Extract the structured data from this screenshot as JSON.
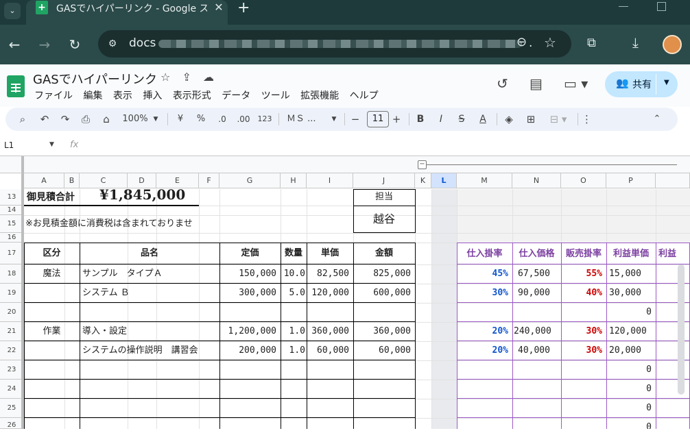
{
  "browser": {
    "tab_title": "GASでハイパーリンク - Google スプ",
    "url_prefix": "docs",
    "url_suffix": "."
  },
  "sheets": {
    "doc_title": "GASでハイパーリンク",
    "menus": [
      "ファイル",
      "編集",
      "表示",
      "挿入",
      "表示形式",
      "データ",
      "ツール",
      "拡張機能",
      "ヘルプ"
    ],
    "share_label": "共有"
  },
  "toolbar": {
    "zoom": "100%",
    "currency": "¥",
    "percent": "%",
    "dec_decrease": ".0",
    "dec_increase": ".00",
    "number_format": "123",
    "font": "ＭＳ ...",
    "font_size": "11",
    "bold": "B",
    "italic": "I",
    "strike": "S",
    "text_color": "A"
  },
  "formula_bar": {
    "name_box": "L1",
    "fx": "fx"
  },
  "columns": [
    "A",
    "B",
    "C",
    "D",
    "E",
    "F",
    "G",
    "H",
    "I",
    "J",
    "K",
    "L",
    "M",
    "N",
    "O",
    "P",
    ""
  ],
  "rows": [
    "13",
    "14",
    "15",
    "16",
    "17",
    "18",
    "19",
    "20",
    "21",
    "22",
    "23",
    "24",
    "25",
    "26"
  ],
  "sheet": {
    "total_label": "御見積合計",
    "total_value": "¥1,845,000",
    "tanto_label": "担当",
    "tanto_name": "越谷",
    "note": "※お見積金額に消費税は含まれておりませ",
    "table_headers": [
      "区分",
      "品名",
      "定価",
      "数量",
      "単価",
      "金額"
    ],
    "lines": [
      {
        "kubun": "魔法",
        "name": "サンプル　タイプＡ",
        "list_price": "150,000",
        "qty": "10.0",
        "unit": "82,500",
        "amount": "825,000"
      },
      {
        "kubun": "",
        "name": "システム Ｂ",
        "list_price": "300,000",
        "qty": "5.0",
        "unit": "120,000",
        "amount": "600,000"
      },
      {
        "kubun": "",
        "name": "",
        "list_price": "",
        "qty": "",
        "unit": "",
        "amount": ""
      },
      {
        "kubun": "作業",
        "name": "導入・設定",
        "list_price": "1,200,000",
        "qty": "1.0",
        "unit": "360,000",
        "amount": "360,000"
      },
      {
        "kubun": "",
        "name": "システムの操作説明　講習会",
        "list_price": "200,000",
        "qty": "1.0",
        "unit": "60,000",
        "amount": "60,000"
      }
    ],
    "side_headers": [
      "仕入掛率",
      "仕入価格",
      "販売掛率",
      "利益単価",
      "利益"
    ],
    "side_rows": [
      {
        "m": "45%",
        "n": "67,500",
        "o": "55%",
        "p": "15,000"
      },
      {
        "m": "30%",
        "n": "90,000",
        "o": "40%",
        "p": "30,000"
      },
      {
        "m": "",
        "n": "",
        "o": "",
        "p": "0"
      },
      {
        "m": "20%",
        "n": "240,000",
        "o": "30%",
        "p": "120,000"
      },
      {
        "m": "20%",
        "n": "40,000",
        "o": "30%",
        "p": "20,000"
      },
      {
        "m": "",
        "n": "",
        "o": "",
        "p": "0"
      },
      {
        "m": "",
        "n": "",
        "o": "",
        "p": "0"
      },
      {
        "m": "",
        "n": "",
        "o": "",
        "p": "0"
      },
      {
        "m": "",
        "n": "",
        "o": "",
        "p": "0"
      }
    ]
  },
  "colors": {
    "sheets_green": "#1fa463",
    "share_bg": "#c2e7ff",
    "accent_blue": "#1155cc",
    "accent_red": "#cc0000",
    "purple": "#7b3fa0"
  }
}
